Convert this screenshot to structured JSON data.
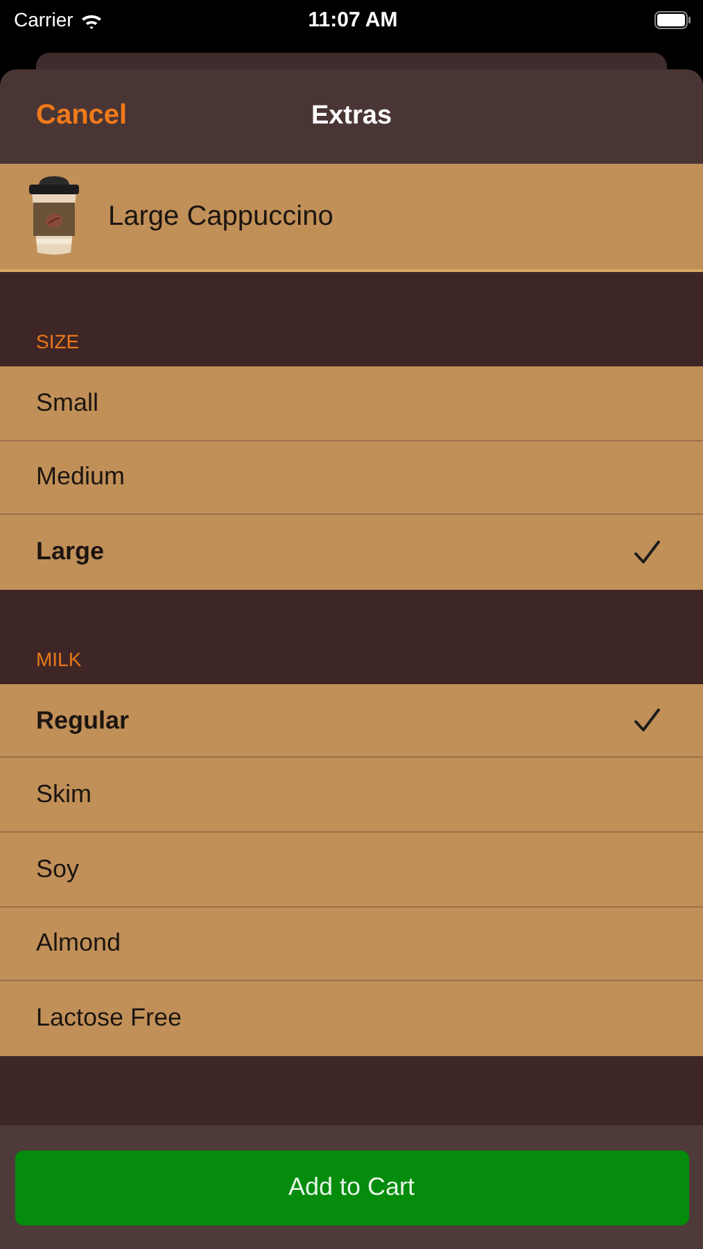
{
  "status_bar": {
    "carrier": "Carrier",
    "time": "11:07 AM"
  },
  "nav": {
    "cancel": "Cancel",
    "title": "Extras"
  },
  "product": {
    "name": "Large Cappuccino"
  },
  "sections": [
    {
      "title": "SIZE",
      "options": [
        {
          "label": "Small",
          "selected": false
        },
        {
          "label": "Medium",
          "selected": false
        },
        {
          "label": "Large",
          "selected": true
        }
      ]
    },
    {
      "title": "MILK",
      "options": [
        {
          "label": "Regular",
          "selected": true
        },
        {
          "label": "Skim",
          "selected": false
        },
        {
          "label": "Soy",
          "selected": false
        },
        {
          "label": "Almond",
          "selected": false
        },
        {
          "label": "Lactose Free",
          "selected": false
        }
      ]
    }
  ],
  "footer": {
    "button": "Add to Cart"
  }
}
